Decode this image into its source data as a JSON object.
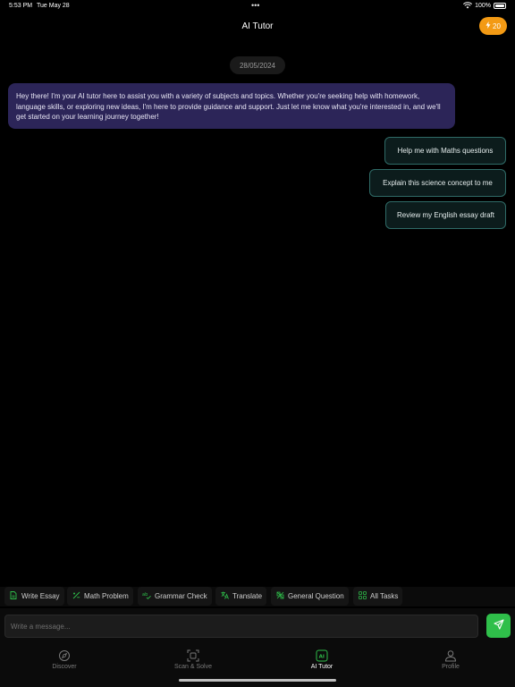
{
  "status_bar": {
    "time": "5:53 PM",
    "date": "Tue May 28",
    "dots": "•••",
    "battery": "100%"
  },
  "header": {
    "title": "AI Tutor",
    "credits": "20"
  },
  "chat": {
    "date": "28/05/2024",
    "ai_message": "Hey there! I'm your AI tutor here to assist you with a variety of subjects and topics. Whether you're seeking help with homework, language skills, or exploring new ideas, I'm here to provide guidance and support. Just let me know what you're interested in, and we'll get started on your learning journey together!",
    "suggestions": [
      "Help me with Maths questions",
      "Explain this science concept to me",
      "Review my English essay draft"
    ]
  },
  "quick_actions": [
    {
      "label": "Write Essay",
      "icon": "document-icon"
    },
    {
      "label": "Math Problem",
      "icon": "math-icon"
    },
    {
      "label": "Grammar Check",
      "icon": "abc-icon"
    },
    {
      "label": "Translate",
      "icon": "translate-icon"
    },
    {
      "label": "General Question",
      "icon": "puzzle-icon"
    },
    {
      "label": "All Tasks",
      "icon": "grid-icon"
    }
  ],
  "composer": {
    "placeholder": "Write a message..."
  },
  "tabs": [
    {
      "label": "Discover",
      "icon": "compass-icon",
      "active": false
    },
    {
      "label": "Scan & Solve",
      "icon": "scan-icon",
      "active": false
    },
    {
      "label": "AI Tutor",
      "icon": "ai-icon",
      "active": true
    },
    {
      "label": "Profile",
      "icon": "person-icon",
      "active": false
    }
  ],
  "colors": {
    "accent": "#2fbf4a",
    "ai_bubble": "#2c2558",
    "badge": "#f39a14",
    "suggestion_border": "#2f6b67"
  }
}
